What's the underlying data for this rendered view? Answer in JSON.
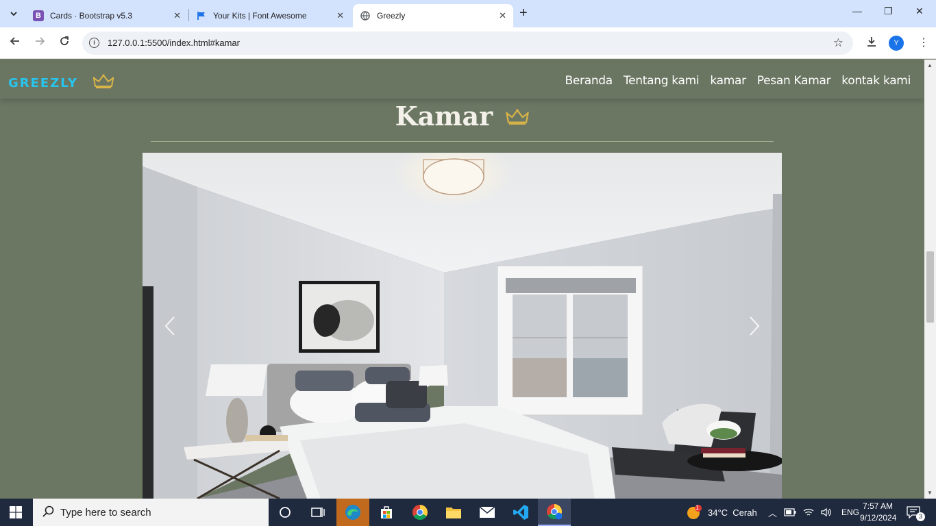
{
  "browser": {
    "tabs": [
      {
        "title": "Cards · Bootstrap v5.3",
        "favicon_letter": "B",
        "favicon_color": "#7952b3",
        "active": false
      },
      {
        "title": "Your Kits | Font Awesome",
        "favicon_letter": "",
        "favicon_color": "#1a73e8",
        "active": false
      },
      {
        "title": "Greezly",
        "favicon_letter": "",
        "favicon_color": "#5f6368",
        "active": true
      }
    ],
    "url": "127.0.0.1:5500/index.html#kamar",
    "profile_initial": "Y"
  },
  "site": {
    "brand": "GREEZLY",
    "nav_links": [
      "Beranda",
      "Tentang kami",
      "kamar",
      "Pesan Kamar",
      "kontak kami"
    ],
    "section_title": "Kamar",
    "colors": {
      "background": "#6c7763",
      "brand": "#28c5ee",
      "crown": "#d9b548",
      "title": "#f4f1ea"
    }
  },
  "taskbar": {
    "search_placeholder": "Type here to search",
    "weather": "34°C  Cerah",
    "weather_badge": "1",
    "language": "ENG",
    "time": "7:57 AM",
    "date": "9/12/2024",
    "notification_count": "3"
  }
}
